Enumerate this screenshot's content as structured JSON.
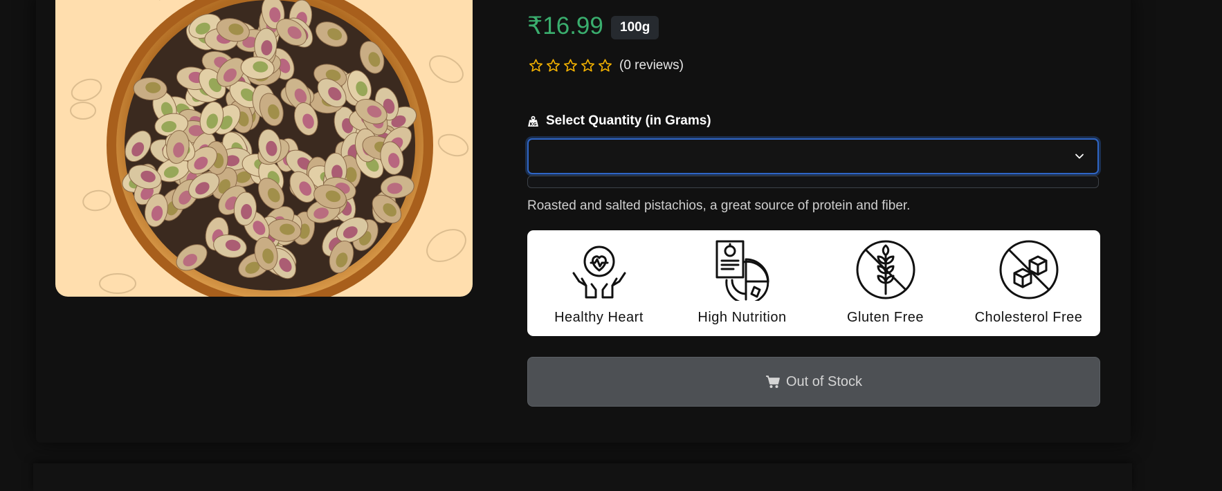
{
  "product": {
    "price": "₹16.99",
    "weight_badge": "100g",
    "rating": 0,
    "rating_max": 5,
    "review_count_text": "(0 reviews)",
    "description": "Roasted and salted pistachios, a great source of protein and fiber."
  },
  "quantity": {
    "label": "Select Quantity (in Grams)",
    "label_icon": "weight-icon",
    "selected_value": ""
  },
  "features": [
    {
      "label": "Healthy Heart",
      "icon": "healthy-heart-icon"
    },
    {
      "label": "High Nutrition",
      "icon": "high-nutrition-icon"
    },
    {
      "label": "Gluten Free",
      "icon": "gluten-free-icon"
    },
    {
      "label": "Cholesterol Free",
      "icon": "cholesterol-free-icon"
    }
  ],
  "stock_button": {
    "label": "Out of Stock",
    "icon": "cart-icon"
  },
  "colors": {
    "price": "#3aae6e",
    "star": "#f5b301",
    "focus_ring": "#2f66c6",
    "image_background": "#ffdeae",
    "button_disabled": "#4d5054"
  }
}
